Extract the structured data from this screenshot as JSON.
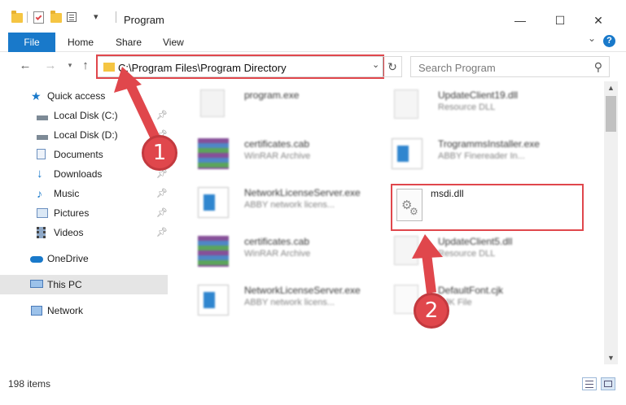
{
  "window": {
    "title": "Program",
    "minimize": "—",
    "maximize": "☐",
    "close": "✕"
  },
  "ribbon": {
    "file": "File",
    "home": "Home",
    "share": "Share",
    "view": "View",
    "expand": "⌄",
    "help": "?"
  },
  "address": {
    "path": "C:\\Program Files\\Program Directory",
    "dropdown": "⌄",
    "refresh": "↻"
  },
  "search": {
    "placeholder": "Search Program",
    "icon": "⚲"
  },
  "sidebar": {
    "quick_access": "Quick access",
    "items": [
      {
        "label": "Local Disk (C:)"
      },
      {
        "label": "Local Disk (D:)"
      },
      {
        "label": "Documents"
      },
      {
        "label": "Downloads"
      },
      {
        "label": "Music"
      },
      {
        "label": "Pictures"
      },
      {
        "label": "Videos"
      }
    ],
    "onedrive": "OneDrive",
    "this_pc": "This PC",
    "network": "Network"
  },
  "files": [
    {
      "name": "program.exe",
      "sub": ""
    },
    {
      "name": "UpdateClient19.dll",
      "sub": "Resource DLL"
    },
    {
      "name": "certificates.cab",
      "sub": "WinRAR Archive"
    },
    {
      "name": "TrogrammsInstaller.exe",
      "sub": "ABBY Finereader In..."
    },
    {
      "name": "NetworkLicenseServer.exe",
      "sub": "ABBY network licens..."
    },
    {
      "name": "msdi.dll",
      "sub": ""
    },
    {
      "name": "certificates.cab",
      "sub": "WinRAR Archive"
    },
    {
      "name": "UpdateClient5.dll",
      "sub": "Resource DLL"
    },
    {
      "name": "NetworkLicenseServer.exe",
      "sub": "ABBY network licens..."
    },
    {
      "name": "DefaultFont.cjk",
      "sub": "CJK File"
    }
  ],
  "status": {
    "count": "198 items"
  },
  "annotations": {
    "step1": "1",
    "step2": "2"
  },
  "colors": {
    "accent": "#1979ca",
    "highlight": "#e0474c",
    "folder": "#f5c542"
  }
}
